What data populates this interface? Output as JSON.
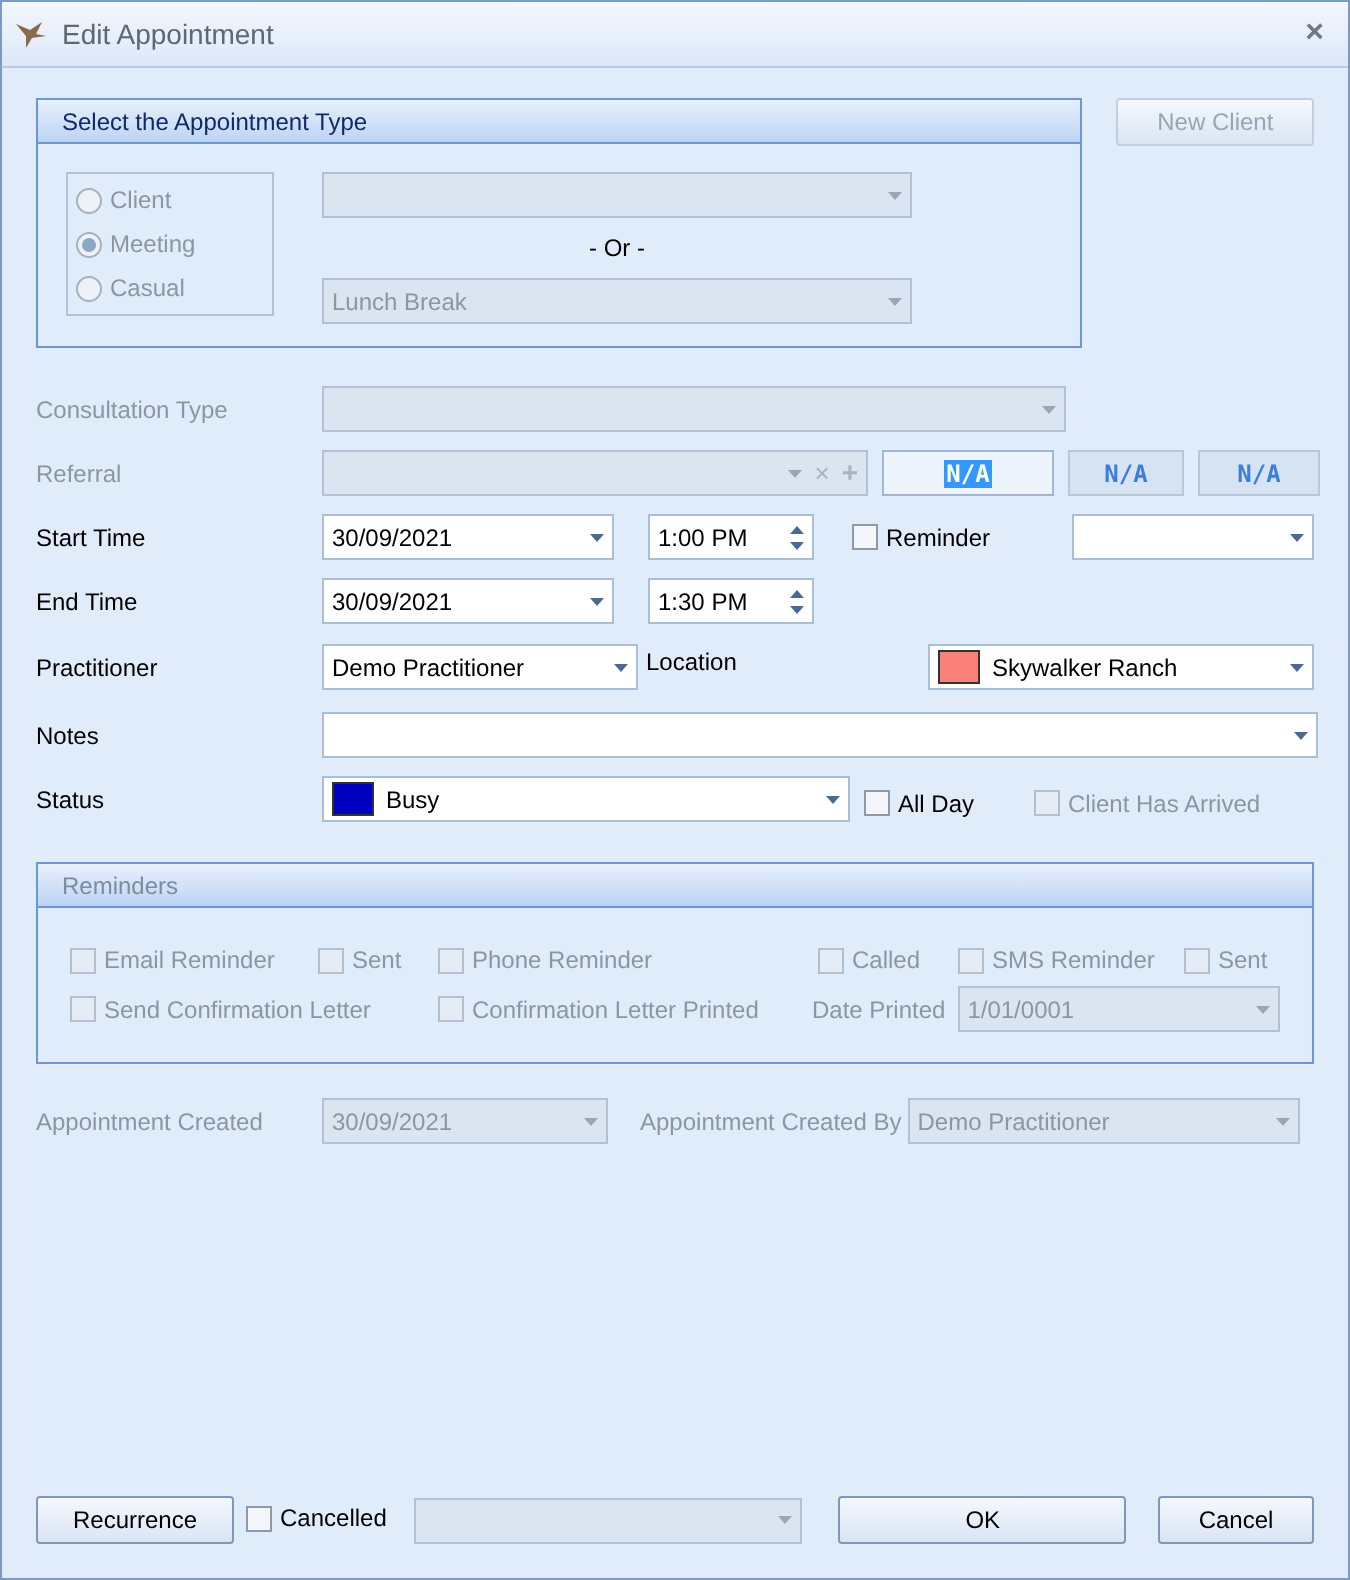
{
  "window": {
    "title": "Edit Appointment",
    "close_glyph": "×"
  },
  "appointment_type": {
    "title": "Select the Appointment Type",
    "disabled": true,
    "options": [
      {
        "label": "Client",
        "selected": false
      },
      {
        "label": "Meeting",
        "selected": true
      },
      {
        "label": "Casual",
        "selected": false
      }
    ],
    "or_label": "- Or -",
    "casual_value": "Lunch Break"
  },
  "new_client_button": {
    "label": "New Client",
    "disabled": true
  },
  "consultation_type": {
    "label": "Consultation Type",
    "disabled": true
  },
  "referral": {
    "label": "Referral",
    "disabled": true,
    "clear_glyph": "×",
    "add_glyph": "+",
    "buttons": [
      {
        "label": "N/A",
        "selected": true
      },
      {
        "label": "N/A",
        "selected": false
      },
      {
        "label": "N/A",
        "selected": false
      }
    ]
  },
  "start_time": {
    "label": "Start Time",
    "date": "30/09/2021",
    "time": "1:00 PM"
  },
  "reminder": {
    "label": "Reminder",
    "checked": false
  },
  "end_time": {
    "label": "End Time",
    "date": "30/09/2021",
    "time": "1:30 PM"
  },
  "practitioner": {
    "label": "Practitioner",
    "value": "Demo Practitioner"
  },
  "location": {
    "label": "Location",
    "value": "Skywalker Ranch",
    "color": "#f88078"
  },
  "notes": {
    "label": "Notes"
  },
  "status": {
    "label": "Status",
    "value": "Busy",
    "color": "#0000c0"
  },
  "all_day": {
    "label": "All Day",
    "checked": false,
    "disabled": false
  },
  "client_has_arrived": {
    "label": "Client Has Arrived",
    "checked": false,
    "disabled": true
  },
  "reminders": {
    "title": "Reminders",
    "disabled": true,
    "row_1": [
      {
        "label": "Email Reminder",
        "checked": false
      },
      {
        "label": "Sent",
        "checked": false
      },
      {
        "label": "Phone Reminder",
        "checked": false
      },
      {
        "label": "Called",
        "checked": false
      },
      {
        "label": "SMS Reminder",
        "checked": false
      },
      {
        "label": "Sent",
        "checked": false
      }
    ],
    "row_2": [
      {
        "label": "Send Confirmation Letter",
        "checked": false
      },
      {
        "label": "Confirmation Letter Printed",
        "checked": false
      }
    ],
    "date_printed": {
      "label": "Date Printed",
      "value": "1/01/0001"
    }
  },
  "appointment_created": {
    "label": "Appointment Created",
    "value": "30/09/2021",
    "disabled": true
  },
  "appointment_created_by": {
    "label": "Appointment Created By",
    "value": "Demo Practitioner",
    "disabled": true
  },
  "footer": {
    "recurrence_button": "Recurrence",
    "cancelled": {
      "label": "Cancelled",
      "checked": false
    },
    "ok_button": "OK",
    "cancel_button": "Cancel"
  }
}
